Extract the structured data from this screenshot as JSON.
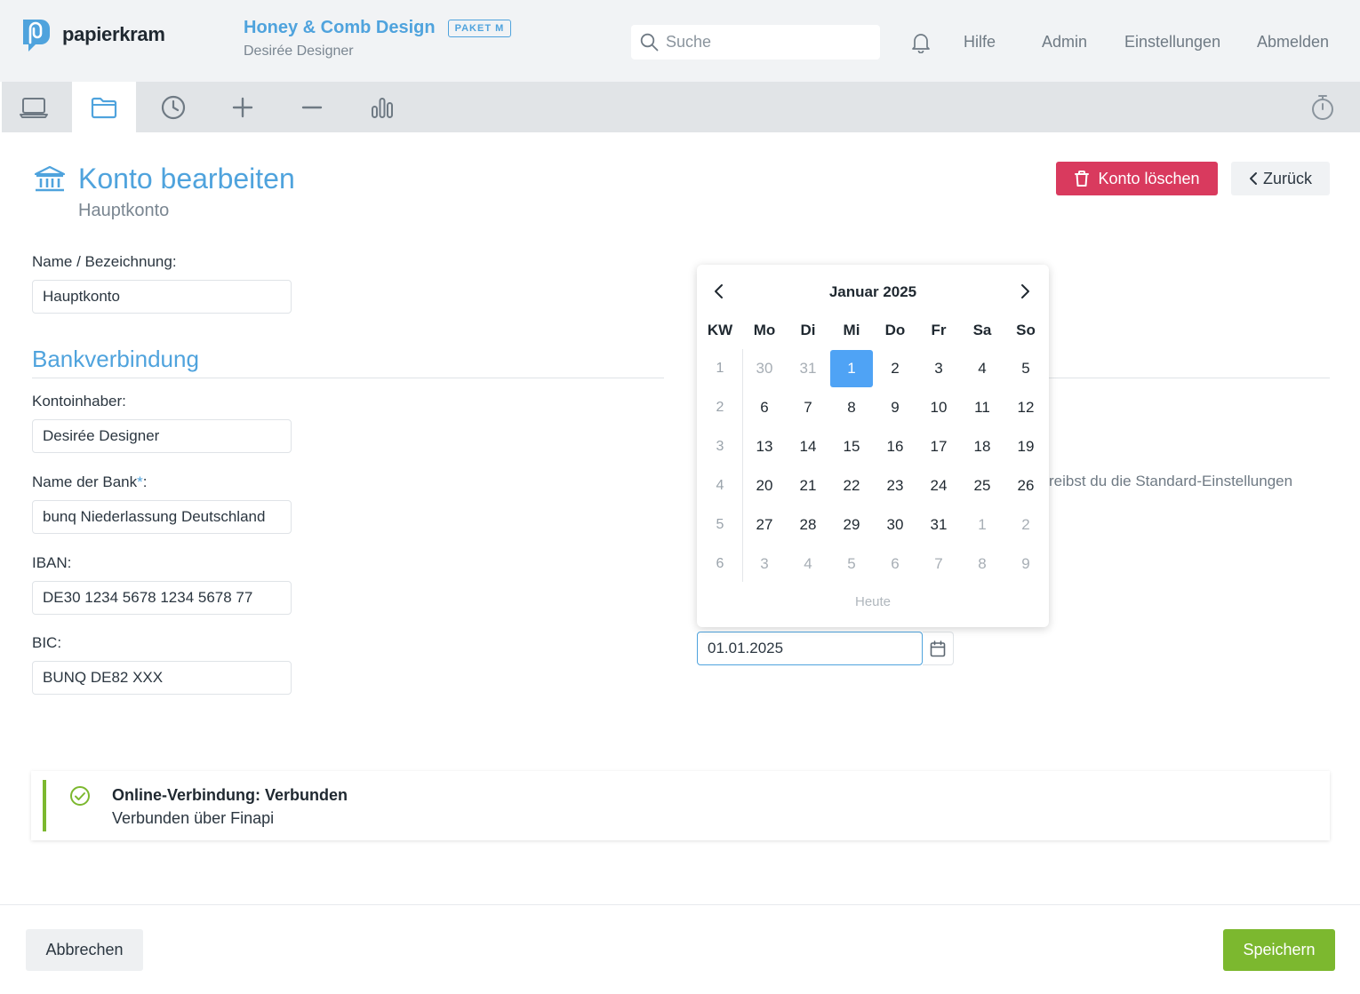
{
  "app": {
    "logo_text": "papierkram"
  },
  "company": {
    "name": "Honey & Comb Design",
    "plan": "PAKET M",
    "user": "Desirée Designer"
  },
  "search": {
    "placeholder": "Suche"
  },
  "topnav": {
    "help": "Hilfe",
    "admin": "Admin",
    "settings": "Einstellungen",
    "logout": "Abmelden"
  },
  "toolbar": {
    "tools": [
      "laptop-icon",
      "folder-icon",
      "clock-icon",
      "plus-icon",
      "minus-icon",
      "bar-chart-icon"
    ],
    "active": "folder-icon",
    "timer": "stopwatch-icon"
  },
  "page": {
    "title": "Konto bearbeiten",
    "subtitle": "Hauptkonto",
    "delete_label": "Konto löschen",
    "back_label": "Zurück"
  },
  "form": {
    "name_label": "Name / Bezeichnung:",
    "name_value": "Hauptkonto",
    "section_title": "Bankverbindung",
    "holder_label": "Kontoinhaber:",
    "holder_value": "Desirée Designer",
    "bank_label": "Name der Bank",
    "bank_required": "*",
    "bank_label_suffix": ":",
    "bank_value": "bunq Niederlassung Deutschland",
    "iban_label": "IBAN:",
    "iban_value": "DE30 1234 5678 1234 5678 77",
    "bic_label": "BIC:",
    "bic_value": "BUNQ DE82 XXX"
  },
  "right_text": "reibst du die Standard-Einstellungen",
  "date": {
    "value": "01.01.2025"
  },
  "calendar": {
    "month": "Januar 2025",
    "headers": [
      "KW",
      "Mo",
      "Di",
      "Mi",
      "Do",
      "Fr",
      "Sa",
      "So"
    ],
    "weeks": [
      {
        "kw": "1",
        "days": [
          {
            "d": "30",
            "m": true
          },
          {
            "d": "31",
            "m": true
          },
          {
            "d": "1",
            "s": true
          },
          {
            "d": "2"
          },
          {
            "d": "3"
          },
          {
            "d": "4"
          },
          {
            "d": "5"
          }
        ]
      },
      {
        "kw": "2",
        "days": [
          {
            "d": "6"
          },
          {
            "d": "7"
          },
          {
            "d": "8"
          },
          {
            "d": "9"
          },
          {
            "d": "10"
          },
          {
            "d": "11"
          },
          {
            "d": "12"
          }
        ]
      },
      {
        "kw": "3",
        "days": [
          {
            "d": "13"
          },
          {
            "d": "14"
          },
          {
            "d": "15"
          },
          {
            "d": "16"
          },
          {
            "d": "17"
          },
          {
            "d": "18"
          },
          {
            "d": "19"
          }
        ]
      },
      {
        "kw": "4",
        "days": [
          {
            "d": "20"
          },
          {
            "d": "21"
          },
          {
            "d": "22"
          },
          {
            "d": "23"
          },
          {
            "d": "24"
          },
          {
            "d": "25"
          },
          {
            "d": "26"
          }
        ]
      },
      {
        "kw": "5",
        "days": [
          {
            "d": "27"
          },
          {
            "d": "28"
          },
          {
            "d": "29"
          },
          {
            "d": "30"
          },
          {
            "d": "31"
          },
          {
            "d": "1",
            "m": true
          },
          {
            "d": "2",
            "m": true
          }
        ]
      },
      {
        "kw": "6",
        "days": [
          {
            "d": "3",
            "m": true
          },
          {
            "d": "4",
            "m": true
          },
          {
            "d": "5",
            "m": true
          },
          {
            "d": "6",
            "m": true
          },
          {
            "d": "7",
            "m": true
          },
          {
            "d": "8",
            "m": true
          },
          {
            "d": "9",
            "m": true
          }
        ]
      }
    ],
    "today_label": "Heute"
  },
  "status": {
    "title": "Online-Verbindung: Verbunden",
    "subtitle": "Verbunden über Finapi"
  },
  "footer": {
    "cancel_label": "Abbrechen",
    "save_label": "Speichern"
  },
  "colors": {
    "accent": "#4fa3dd",
    "danger": "#d93a5e",
    "success": "#7cb82f",
    "selected_day": "#4fa3f5"
  }
}
